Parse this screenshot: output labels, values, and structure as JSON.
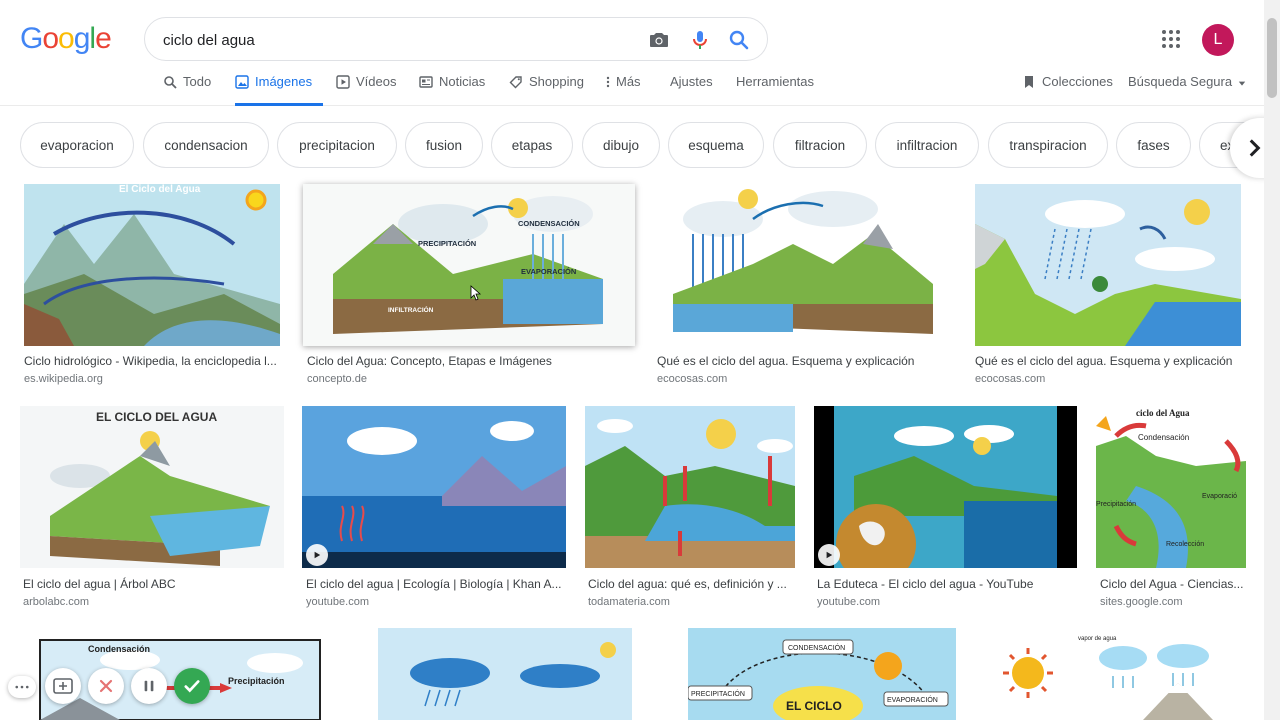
{
  "search": {
    "query": "ciclo del agua"
  },
  "avatar_letter": "L",
  "tabs": [
    {
      "label": "Todo"
    },
    {
      "label": "Imágenes"
    },
    {
      "label": "Vídeos"
    },
    {
      "label": "Noticias"
    },
    {
      "label": "Shopping"
    },
    {
      "label": "Más"
    },
    {
      "label": "Ajustes"
    },
    {
      "label": "Herramientas"
    }
  ],
  "right_links": {
    "collections": "Colecciones",
    "safe_search": "Búsqueda Segura"
  },
  "chips": [
    "evaporacion",
    "condensacion",
    "precipitacion",
    "fusion",
    "etapas",
    "dibujo",
    "esquema",
    "filtracion",
    "infiltracion",
    "transpiracion",
    "fases",
    "ex"
  ],
  "results": [
    {
      "title": "Ciclo hidrológico - Wikipedia, la enciclopedia l...",
      "source": "es.wikipedia.org",
      "image_text": "El Ciclo del Agua"
    },
    {
      "title": "Ciclo del Agua: Concepto, Etapas e Imágenes",
      "source": "concepto.de",
      "image_labels": [
        "CONDENSACIÓN",
        "PRECIPITACIÓN",
        "EVAPORACIÓN",
        "INFILTRACIÓN"
      ]
    },
    {
      "title": "Qué es el ciclo del agua. Esquema y explicación",
      "source": "ecocosas.com"
    },
    {
      "title": "Qué es el ciclo del agua. Esquema y explicación",
      "source": "ecocosas.com"
    },
    {
      "title": "El ciclo del agua | Árbol ABC",
      "source": "arbolabc.com",
      "image_text": "EL CICLO DEL AGUA"
    },
    {
      "title": "El ciclo del agua | Ecología | Biología | Khan A...",
      "source": "youtube.com"
    },
    {
      "title": "Ciclo del agua: qué es, definición y ...",
      "source": "todamateria.com"
    },
    {
      "title": "La Eduteca - El ciclo del agua - YouTube",
      "source": "youtube.com"
    },
    {
      "title": "Ciclo del Agua - Ciencias...",
      "source": "sites.google.com",
      "image_labels": [
        "ciclo del Agua",
        "Condensación",
        "Precipitación",
        "Evaporació",
        "Recolección"
      ]
    },
    {
      "image_labels": [
        "Condensación",
        "Precipitación"
      ]
    },
    {
      "image_labels": []
    },
    {
      "image_labels": [
        "CONDENSACIÓN",
        "PRECIPITACIÓN",
        "EL CICLO",
        "EVAPORACIÓN"
      ]
    },
    {
      "image_labels": [
        "vapor de agua"
      ]
    }
  ],
  "colors": {
    "accent": "#1a73e8",
    "avatar": "#c2185b"
  }
}
